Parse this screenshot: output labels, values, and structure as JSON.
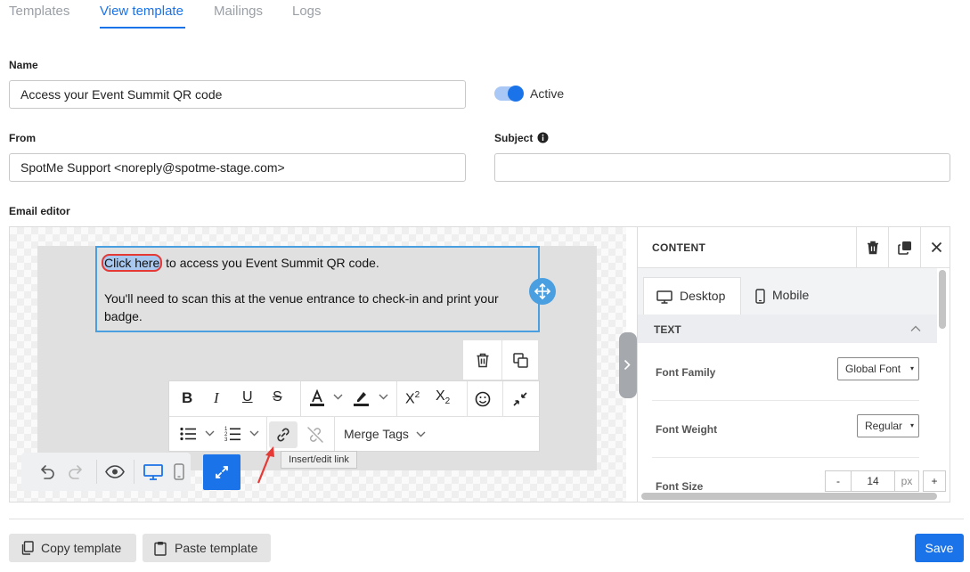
{
  "tabs": [
    {
      "label": "Templates",
      "active": false
    },
    {
      "label": "View template",
      "active": true
    },
    {
      "label": "Mailings",
      "active": false
    },
    {
      "label": "Logs",
      "active": false
    }
  ],
  "form": {
    "name_label": "Name",
    "name_value": "Access your Event Summit QR code",
    "active_label": "Active",
    "active": true,
    "from_label": "From",
    "from_value": "SpotMe Support <noreply@spotme-stage.com>",
    "subject_label": "Subject",
    "subject_value": "",
    "editor_label": "Email editor"
  },
  "email": {
    "link_text": "Click here",
    "line1_rest": " to access you Event Summit QR code.",
    "line2": "You'll need to scan this at the venue entrance to check-in and print your",
    "line3": "badge."
  },
  "toolbar": {
    "merge_tags_label": "Merge Tags",
    "tooltip": "Insert/edit link"
  },
  "sidebar": {
    "title": "CONTENT",
    "tab_desktop": "Desktop",
    "tab_mobile": "Mobile",
    "section_title": "TEXT",
    "font_family_label": "Font Family",
    "font_family_value": "Global Font",
    "font_weight_label": "Font Weight",
    "font_weight_value": "Regular",
    "font_size_label": "Font Size",
    "font_size_value": "14",
    "font_size_unit": "px",
    "minus": "-",
    "plus": "+"
  },
  "footer": {
    "copy_label": "Copy template",
    "paste_label": "Paste template",
    "save_label": "Save"
  },
  "colors": {
    "accent": "#1a73e8",
    "selection_outline": "#4a9fe0",
    "annotation_red": "#e53935"
  }
}
